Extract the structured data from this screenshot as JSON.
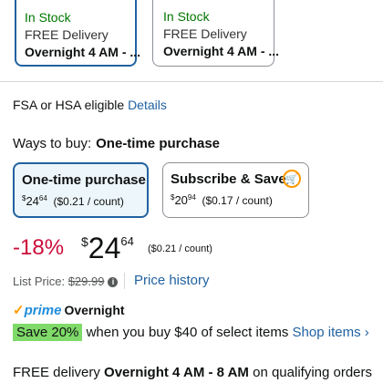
{
  "delivery_options": [
    {
      "prime": "prime",
      "stock": "In Stock",
      "delivery": "FREE Delivery",
      "eta": "Overnight 4 AM - ..."
    },
    {
      "prime": "prime",
      "stock": "In Stock",
      "delivery": "FREE Delivery",
      "eta": "Overnight 4 AM - ..."
    }
  ],
  "fsa": {
    "text": "FSA or HSA eligible",
    "link": "Details"
  },
  "ways_to_buy": {
    "label": "Ways to buy:",
    "selected": "One-time purchase"
  },
  "buy_options": [
    {
      "title": "One-time purchase",
      "symbol": "$",
      "whole": "24",
      "fraction": "64",
      "unit": "($0.21 / count)"
    },
    {
      "title": "Subscribe & Save",
      "symbol": "$",
      "whole": "20",
      "fraction": "94",
      "unit": "($0.17 / count)"
    }
  ],
  "price": {
    "discount": "-18%",
    "symbol": "$",
    "whole": "24",
    "fraction": "64",
    "unit": "($0.21 / count)"
  },
  "list_price": {
    "label": "List Price:",
    "value": "$29.99",
    "history_link": "Price history"
  },
  "prime_shipping": {
    "check": "✓",
    "prime": "prime",
    "label": "Overnight"
  },
  "promo": {
    "badge": "Save 20%",
    "text": "when you buy $40 of select items",
    "link": "Shop items ›"
  },
  "free_delivery": {
    "prefix": "FREE delivery",
    "window": "Overnight 4 AM - 8 AM",
    "suffix": "on qualifying orders"
  },
  "colors": {
    "accent": "#2162a1",
    "deal": "#cc0c39",
    "instock": "#007600",
    "badge": "#7fda69"
  }
}
